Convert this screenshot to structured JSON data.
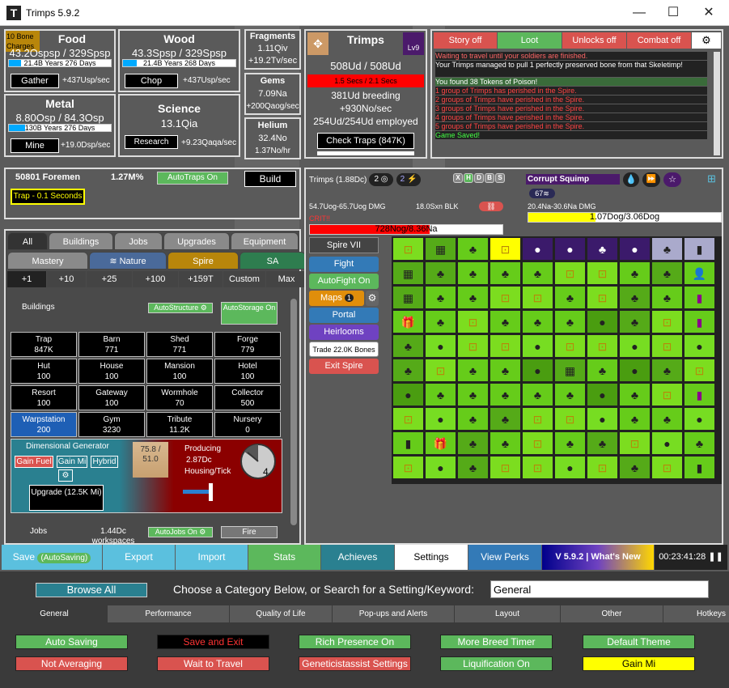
{
  "window": {
    "title": "Trimps 5.9.2",
    "icon_letter": "T"
  },
  "food": {
    "label": "Food",
    "rate": "43.2Ospsp / 329Spsp",
    "bar_text": "21.4B Years 276 Days",
    "bar_pct": 6,
    "btn": "Gather",
    "per": "+437Usp/sec",
    "bone_charges": "10 Bone Charges"
  },
  "wood": {
    "label": "Wood",
    "rate": "43.3Spsp / 329Spsp",
    "bar_text": "21.4B Years 268 Days",
    "bar_pct": 6,
    "btn": "Chop",
    "per": "+437Usp/sec"
  },
  "metal": {
    "label": "Metal",
    "rate": "8.80Osp / 84.3Osp",
    "bar_text": "130B Years 276 Days",
    "bar_pct": 8,
    "btn": "Mine",
    "per": "+19.0Dsp/sec"
  },
  "science": {
    "label": "Science",
    "amount": "13.1Qia",
    "btn": "Research",
    "per": "+9.23Qaqa/sec"
  },
  "fragments": {
    "label": "Fragments",
    "amount": "1.11Qiv",
    "per": "+19.2Tv/sec"
  },
  "gems": {
    "label": "Gems",
    "amount": "7.09Na",
    "per": "+200Qaog/sec"
  },
  "helium": {
    "label": "Helium",
    "amount": "32.4No",
    "per": "1.37No/hr"
  },
  "trimps": {
    "label": "Trimps",
    "count": "508Ud / 508Ud",
    "breed_bar": "1.5 Secs / 2.1 Secs",
    "breeding": "381Ud breeding",
    "per": "+930No/sec",
    "employed": "254Ud/254Ud employed",
    "check": "Check Traps (847K)",
    "level": "Lv9"
  },
  "log": {
    "tabs": [
      "Story off",
      "Loot",
      "Unlocks off",
      "Combat off"
    ],
    "lines": [
      {
        "t": "Waiting to travel until your soldiers are finished.",
        "c": "#ff6666"
      },
      {
        "t": "Your Trimps managed to pull 1 perfectly preserved bone from that Skeletimp!",
        "c": "#ffffff"
      },
      {
        "t": "You found 38 Tokens of Poison!",
        "c": "#ffffff"
      },
      {
        "t": "1 group of Trimps has perished in the Spire.",
        "c": "#ff4444"
      },
      {
        "t": "2 groups of Trimps have perished in the Spire.",
        "c": "#ff4444"
      },
      {
        "t": "3 groups of Trimps have perished in the Spire.",
        "c": "#ff4444"
      },
      {
        "t": "4 groups of Trimps have perished in the Spire.",
        "c": "#ff4444"
      },
      {
        "t": "5 groups of Trimps have perished in the Spire.",
        "c": "#ff4444"
      },
      {
        "t": "Game Saved!",
        "c": "#44ff44"
      }
    ]
  },
  "foremen": {
    "count": "50801 Foremen",
    "pct": "1.27M%",
    "autotraps": "AutoTraps On",
    "build": "Build",
    "trap": "Trap - 0.1 Seconds"
  },
  "tabs": {
    "row1": [
      "All",
      "Buildings",
      "Jobs",
      "Upgrades",
      "Equipment"
    ],
    "row2": [
      "Mastery",
      "≋ Nature",
      "Spire",
      "SA"
    ],
    "amounts": [
      "+1",
      "+10",
      "+25",
      "+100",
      "+159T",
      "Custom",
      "Max"
    ]
  },
  "buildings": {
    "label": "Buildings",
    "auto_structure": "AutoStructure",
    "auto_storage": "AutoStorage On",
    "list": [
      {
        "n": "Trap",
        "v": "847K"
      },
      {
        "n": "Barn",
        "v": "771"
      },
      {
        "n": "Shed",
        "v": "771"
      },
      {
        "n": "Forge",
        "v": "779"
      },
      {
        "n": "Hut",
        "v": "100"
      },
      {
        "n": "House",
        "v": "100"
      },
      {
        "n": "Mansion",
        "v": "100"
      },
      {
        "n": "Hotel",
        "v": "100"
      },
      {
        "n": "Resort",
        "v": "100"
      },
      {
        "n": "Gateway",
        "v": "100"
      },
      {
        "n": "Wormhole",
        "v": "70"
      },
      {
        "n": "Collector",
        "v": "500"
      },
      {
        "n": "Warpstation",
        "v": "200"
      },
      {
        "n": "Gym",
        "v": "3230"
      },
      {
        "n": "Tribute",
        "v": "11.2K"
      },
      {
        "n": "Nursery",
        "v": "0"
      }
    ]
  },
  "dg": {
    "title": "Dimensional Generator",
    "gain_fuel": "Gain Fuel",
    "gain_mi": "Gain Mi",
    "hybrid": "Hybrid",
    "upgrade": "Upgrade (12.5K Mi)",
    "fuel": "75.8 / 51.0",
    "producing": "Producing",
    "amount": "2.87Dc",
    "unit": "Housing/Tick",
    "clock": "4"
  },
  "jobs": {
    "label": "Jobs",
    "workspaces": "1.44Dc workspaces",
    "autojobs": "AutoJobs On",
    "fire": "Fire"
  },
  "battle": {
    "trimps": "Trimps (1.88Dc)",
    "badge1": "2",
    "badge2": "2",
    "dmg": "54.7Uog-65.7Uog DMG",
    "blk": "18.0Sxn BLK",
    "crit": "CRIT!!",
    "hp": "728Nog/8.36Na",
    "enemy": "Corrupt Squimp",
    "enemy_badge": "67≋",
    "enemy_dmg": "20.4Na-30.6Na DMG",
    "enemy_hp": "1.07Dog/3.06Dog",
    "letters": [
      "X",
      "H",
      "D",
      "B",
      "S"
    ]
  },
  "spire": {
    "label": "Spire VII",
    "fight": "Fight",
    "autofight": "AutoFight On",
    "maps": "Maps",
    "maps_count": "1",
    "portal": "Portal",
    "heirlooms": "Heirlooms",
    "trade": "Trade 22.0K Bones",
    "exit": "Exit Spire"
  },
  "bottom": {
    "save": "Save",
    "saving": "(AutoSaving)",
    "export": "Export",
    "import": "Import",
    "stats": "Stats",
    "achieves": "Achieves",
    "settings": "Settings",
    "perks": "View Perks",
    "version": "V 5.9.2 | What's New",
    "time": "00:23:41:28"
  },
  "settings": {
    "browse": "Browse All",
    "prompt": "Choose a Category Below, or Search for a Setting/Keyword:",
    "search_value": "General",
    "cats": [
      "General",
      "Performance",
      "Quality of Life",
      "Pop-ups and Alerts",
      "Layout",
      "Other",
      "Hotkeys"
    ],
    "row1": [
      "Auto Saving",
      "Save and Exit",
      "Rich Presence On",
      "More Breed Timer",
      "Default Theme"
    ],
    "row2": [
      "Not Averaging",
      "Wait to Travel",
      "Geneticistassist Settings",
      "Liquification On",
      "Gain Mi"
    ]
  }
}
